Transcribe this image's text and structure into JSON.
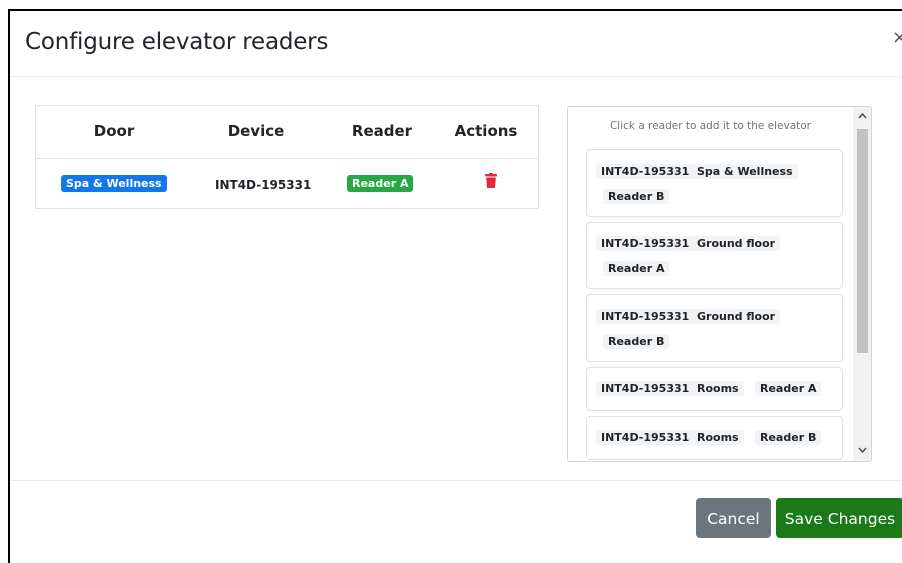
{
  "modal": {
    "title": "Configure elevator readers",
    "close_glyph": "×"
  },
  "table": {
    "headers": [
      "Door",
      "Device",
      "Reader",
      "Actions"
    ],
    "rows": [
      {
        "door": "Spa & Wellness",
        "device": "INT4D-195331",
        "reader": "Reader A",
        "action_icon": "trash-icon"
      }
    ]
  },
  "reader_panel": {
    "hint": "Click a reader to add it to the elevator",
    "items": [
      {
        "device": "INT4D-195331",
        "door": "Spa & Wellness",
        "reader": "Reader B"
      },
      {
        "device": "INT4D-195331",
        "door": "Ground floor",
        "reader": "Reader A"
      },
      {
        "device": "INT4D-195331",
        "door": "Ground floor",
        "reader": "Reader B"
      },
      {
        "device": "INT4D-195331",
        "door": "Rooms",
        "reader": "Reader A"
      },
      {
        "device": "INT4D-195331",
        "door": "Rooms",
        "reader": "Reader B"
      }
    ]
  },
  "footer": {
    "cancel_label": "Cancel",
    "save_label": "Save Changes"
  },
  "colors": {
    "door_badge": "#1177ee",
    "reader_badge": "#28a745",
    "delete_icon": "#e0293e",
    "cancel_button": "#6c757d",
    "save_button": "#1a7a1a"
  }
}
